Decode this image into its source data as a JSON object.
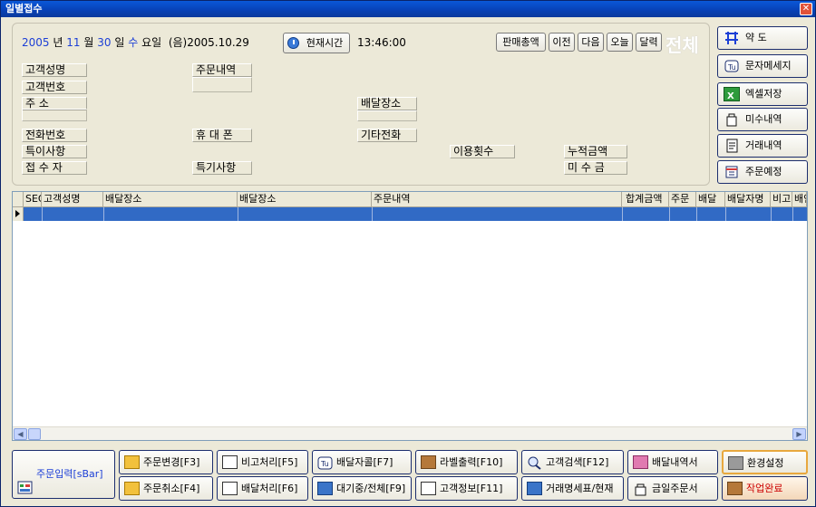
{
  "window": {
    "title": "일별접수",
    "close_label": "✕"
  },
  "date_bar": {
    "year": "2005",
    "year_unit": "년",
    "month": "11",
    "month_unit": "월",
    "day": "30",
    "day_unit": "일",
    "weekday": "수",
    "weekday_unit": "요일",
    "lunar": "(음)2005.10.29",
    "current_time_button": "현재시간",
    "time": "13:46:00"
  },
  "nav_buttons": [
    "판매총액",
    "이전",
    "다음",
    "오늘",
    "달력"
  ],
  "total_label": "전체",
  "fields": {
    "customer_name": "고객성명",
    "customer_number": "고객번호",
    "address": "주      소",
    "phone": "전화번호",
    "remarks": "특이사항",
    "receiver": "접 수 자",
    "order_detail": "주문내역",
    "mobile": "휴 대 폰",
    "special": "특기사항",
    "delivery_place": "배달장소",
    "other_phone": "기타전화",
    "use_count": "이용횟수",
    "accumulated": "누적금액",
    "unpaid": "미 수 금"
  },
  "side_buttons": [
    {
      "label": "약 도",
      "icon": "map-icon"
    },
    {
      "label": "문자메세지",
      "icon": "message-icon"
    },
    {
      "label": "엑셀저장",
      "icon": "excel-icon"
    },
    {
      "label": "미수내역",
      "icon": "bag-icon"
    },
    {
      "label": "거래내역",
      "icon": "document-icon"
    },
    {
      "label": "주문예정",
      "icon": "calendar-icon"
    }
  ],
  "grid": {
    "columns": [
      "SEQ",
      "고객성명",
      "배달장소",
      "배달장소",
      "주문내역",
      "합계금액",
      "주문",
      "배달",
      "배달자명",
      "비고",
      "배인"
    ]
  },
  "bottom_buttons": {
    "order_input": "주문입력[sBar]",
    "row1": [
      "주문변경[F3]",
      "비고처리[F5]",
      "배달자콜[F7]",
      "라벨출력[F10]",
      "고객검색[F12]",
      "배달내역서",
      "환경설정"
    ],
    "row2": [
      "주문취소[F4]",
      "배달처리[F6]",
      "대기중/전체[F9]",
      "고객정보[F11]",
      "거래명세표/현재",
      "금일주문서",
      "작업완료"
    ]
  }
}
